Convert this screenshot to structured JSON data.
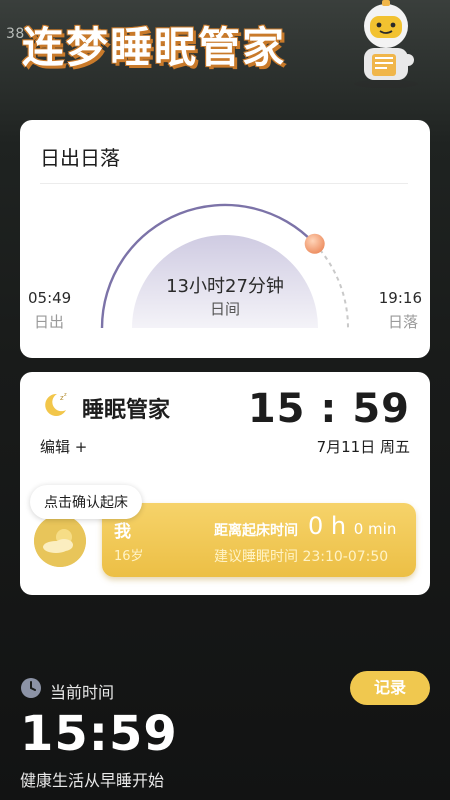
{
  "status_bar": {
    "time": "38"
  },
  "app": {
    "title": "连梦睡眠管家"
  },
  "sun_card": {
    "title": "日出日落",
    "day_length": "13小时27分钟",
    "day_label": "日间",
    "sunrise_time": "05:49",
    "sunrise_label": "日出",
    "sunset_time": "19:16",
    "sunset_label": "日落",
    "progress_fraction": 0.76
  },
  "sleep_card": {
    "title": "睡眠管家",
    "clock": "15 : 59",
    "edit_label": "编辑 +",
    "date": "7月11日 周五",
    "confirm_bubble": "点击确认起床",
    "user": {
      "name": "我",
      "age": "16岁",
      "wake_label": "距离起床时间",
      "wake_hours": "0 h",
      "wake_minutes": "0 min",
      "bed_suggestion": "建议睡眠时间 23:10-07:50"
    }
  },
  "footer": {
    "now_label": "当前时间",
    "record_button": "记录",
    "now_time": "15:59",
    "slogan": "健康生活从早睡开始"
  },
  "colors": {
    "accent": "#f0c84f",
    "arc": "#7c73a8",
    "sun_dot": "#f0956a"
  }
}
